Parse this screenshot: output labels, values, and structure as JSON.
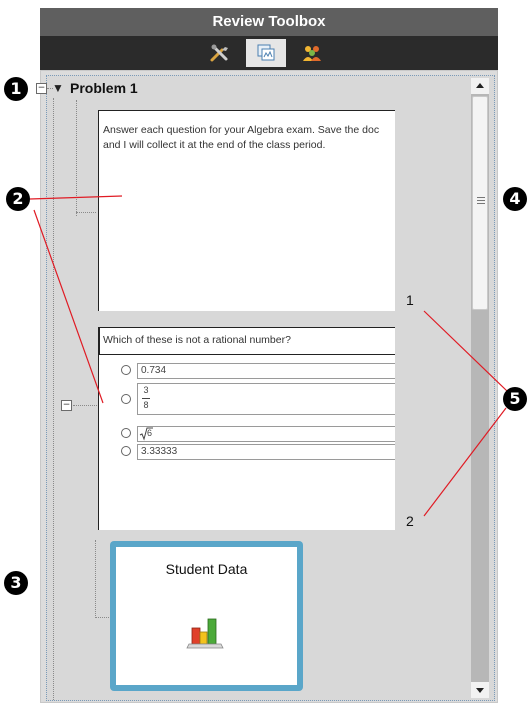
{
  "header": {
    "title": "Review Toolbox"
  },
  "tabs": [
    {
      "icon": "tools-icon",
      "active": false
    },
    {
      "icon": "pages-icon",
      "active": true
    },
    {
      "icon": "class-icon",
      "active": false
    }
  ],
  "tree": {
    "problem_title": "Problem 1",
    "expander_symbol": "−"
  },
  "page1": {
    "text": "Answer each question for your Algebra exam.  Save the doc\nand I will collect it at the end of the class period."
  },
  "page2": {
    "question": "Which of these is not a rational number?",
    "choices": [
      {
        "value": "0.734"
      },
      {
        "numerator": "3",
        "denominator": "8"
      },
      {
        "radicand": "6"
      },
      {
        "value": "3.33333"
      }
    ]
  },
  "card": {
    "title": "Student Data"
  },
  "callouts": [
    "1",
    "2",
    "3",
    "4",
    "5"
  ],
  "page_numbers": [
    "1",
    "2"
  ],
  "colors": {
    "callout_line": "#e01b24",
    "card_border": "#5aa6c9",
    "header_bg": "#5f5f5f"
  }
}
